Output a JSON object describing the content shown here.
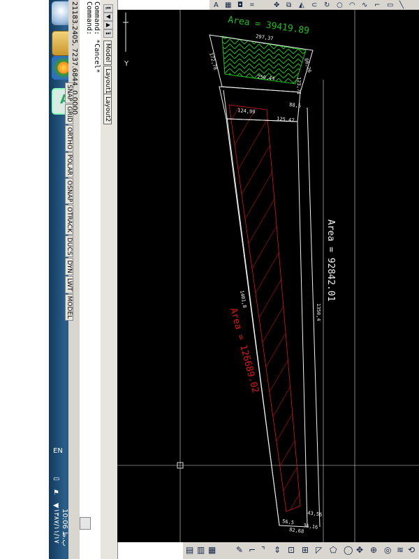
{
  "taskbar": {
    "language": "EN",
    "clock": "10:06 ‫ب.ظ‬",
    "date": "۱۳۸۷/۱۱/۱۷"
  },
  "statusbar": {
    "coords": "21183.2405, 7237.6844, 0.0000",
    "buttons": [
      "SNAP",
      "GRID",
      "ORTHO",
      "POLAR",
      "OSNAP",
      "OTRACK",
      "DUCS",
      "DYN",
      "LWT",
      "MODEL"
    ]
  },
  "command": {
    "line1": "Command: *Cancel*",
    "line2": "Command:"
  },
  "tabs": [
    "Model",
    "Layout1",
    "Layout2"
  ],
  "drawing": {
    "area_top": "Area = 39419.89",
    "area_right": "Area = 92842.01",
    "area_hatch": "Area = 126689.02",
    "dim_top": "297,37",
    "dim_left_top": "172,78",
    "dim_right_top": "86,26",
    "dim_mid": "250,44",
    "dim_small_right": "123,71",
    "dim_mid_left": "124,99",
    "dim_mid_right": "125,47",
    "dim_gap": "88,5",
    "dim_long_left": "1401,8",
    "dim_long_right": "1350,4",
    "dim_bottom_1": "56,5",
    "dim_bottom_2": "82,68",
    "dim_bottom_3": "36,16",
    "dim_bottom_4": "43,56",
    "colors": {
      "green": "#1fbf1f",
      "red": "#e01515",
      "white": "#f2f2f2",
      "background": "#000000"
    }
  }
}
